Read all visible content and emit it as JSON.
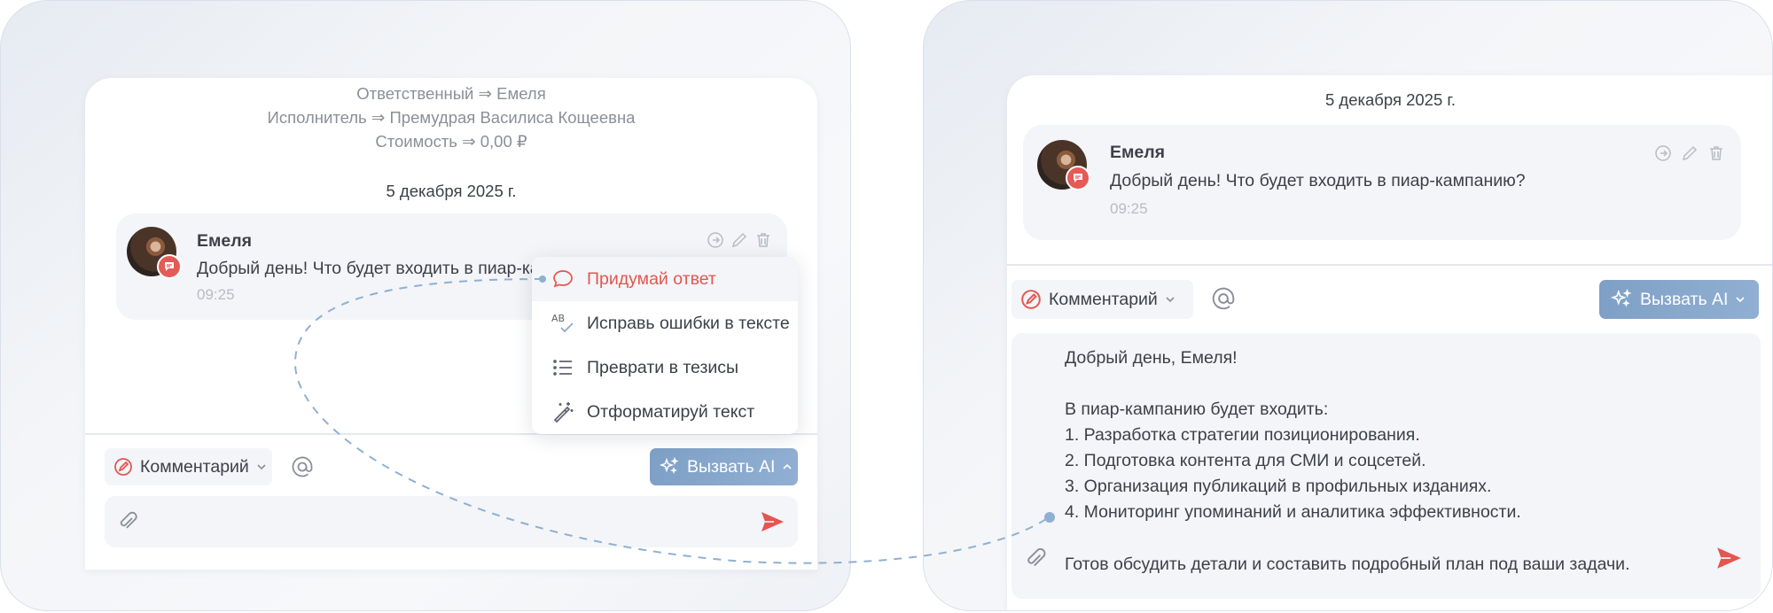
{
  "left": {
    "system_lines": [
      "Ответственный ⇒ Емеля",
      "Исполнитель ⇒ Премудрая Василиса Кощеевна",
      "Стоимость ⇒ 0,00 ₽"
    ],
    "date": "5 декабря 2025 г.",
    "message": {
      "author": "Емеля",
      "text": "Добрый день! Что будет входить в пиар-кам",
      "time": "09:25"
    },
    "toolbar": {
      "comment_label": "Комментарий",
      "ai_label": "Вызвать AI"
    },
    "ai_menu": {
      "items": [
        {
          "label": "Придумай ответ",
          "icon": "speech-bubble-icon",
          "active": true
        },
        {
          "label": "Исправь ошибки в тексте",
          "icon": "spellcheck-icon",
          "active": false
        },
        {
          "label": "Преврати в тезисы",
          "icon": "list-icon",
          "active": false
        },
        {
          "label": "Отформатируй текст",
          "icon": "magic-wand-icon",
          "active": false
        }
      ]
    }
  },
  "right": {
    "date": "5 декабря 2025 г.",
    "message": {
      "author": "Емеля",
      "text": "Добрый день! Что будет входить в пиар-кампанию?",
      "time": "09:25"
    },
    "toolbar": {
      "comment_label": "Комментарий",
      "ai_label": "Вызвать AI"
    },
    "reply_lines": [
      "Добрый день, Емеля!",
      "",
      "В пиар-кампанию будет входить:",
      "1. Разработка стратегии позиционирования.",
      "2. Подготовка контента для СМИ и соцсетей.",
      "3. Организация публикаций в профильных изданиях.",
      "4. Мониторинг упоминаний и аналитика эффективности.",
      "",
      "Готов обсудить детали и составить подробный план под ваши задачи."
    ]
  },
  "colors": {
    "accent_red": "#e4564f",
    "ai_blue": "#87a7cc",
    "bubble_bg": "#f3f5f8",
    "connector": "#8fb0d2"
  }
}
